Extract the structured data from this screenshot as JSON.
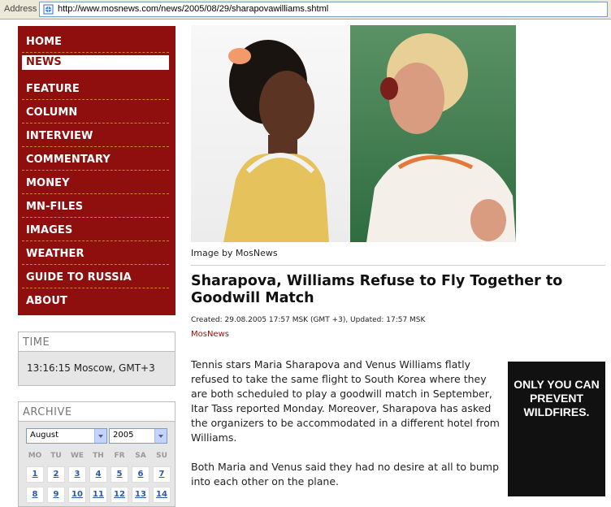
{
  "browser": {
    "address_label": "Address",
    "url": "http://www.mosnews.com/news/2005/08/29/sharapovawilliams.shtml"
  },
  "nav": {
    "items": [
      {
        "label": "HOME"
      },
      {
        "label": "NEWS",
        "active": true
      },
      {
        "label": "FEATURE"
      },
      {
        "label": "COLUMN"
      },
      {
        "label": "INTERVIEW"
      },
      {
        "label": "COMMENTARY"
      },
      {
        "label": "MONEY"
      },
      {
        "label": "MN-FILES"
      },
      {
        "label": "IMAGES"
      },
      {
        "label": "WEATHER"
      },
      {
        "label": "GUIDE TO RUSSIA"
      },
      {
        "label": "ABOUT"
      }
    ]
  },
  "time": {
    "title": "TIME",
    "value": "13:16:15 Moscow, GMT+3"
  },
  "archive": {
    "title": "ARCHIVE",
    "month": "August",
    "year": "2005",
    "weekdays": [
      "MO",
      "TU",
      "WE",
      "TH",
      "FR",
      "SA",
      "SU"
    ],
    "week1": [
      "1",
      "2",
      "3",
      "4",
      "5",
      "6",
      "7"
    ],
    "week2": [
      "8",
      "9",
      "10",
      "11",
      "12",
      "13",
      "14"
    ]
  },
  "article": {
    "image_caption": "Image by MosNews",
    "headline": "Sharapova, Williams Refuse to Fly Together to Goodwill Match",
    "meta": "Created: 29.08.2005 17:57 MSK (GMT +3), Updated: 17:57 MSK",
    "source": "MosNews",
    "paragraph1": "Tennis stars Maria Sharapova and Venus Williams flatly refused to take the same flight to South Korea where they are both scheduled to play a goodwill match in September, Itar Tass reported Monday. Moreover, Sharapova has asked the organizers to be accommodated in a different hotel from Williams.",
    "paragraph2": "Both Maria and Venus said they had no desire at all to bump into each other on the plane."
  },
  "ad": {
    "text": "ONLY YOU CAN PREVENT WILDFIRES."
  },
  "colors": {
    "nav_bg": "#8f0f0f",
    "link": "#2b58a8"
  }
}
